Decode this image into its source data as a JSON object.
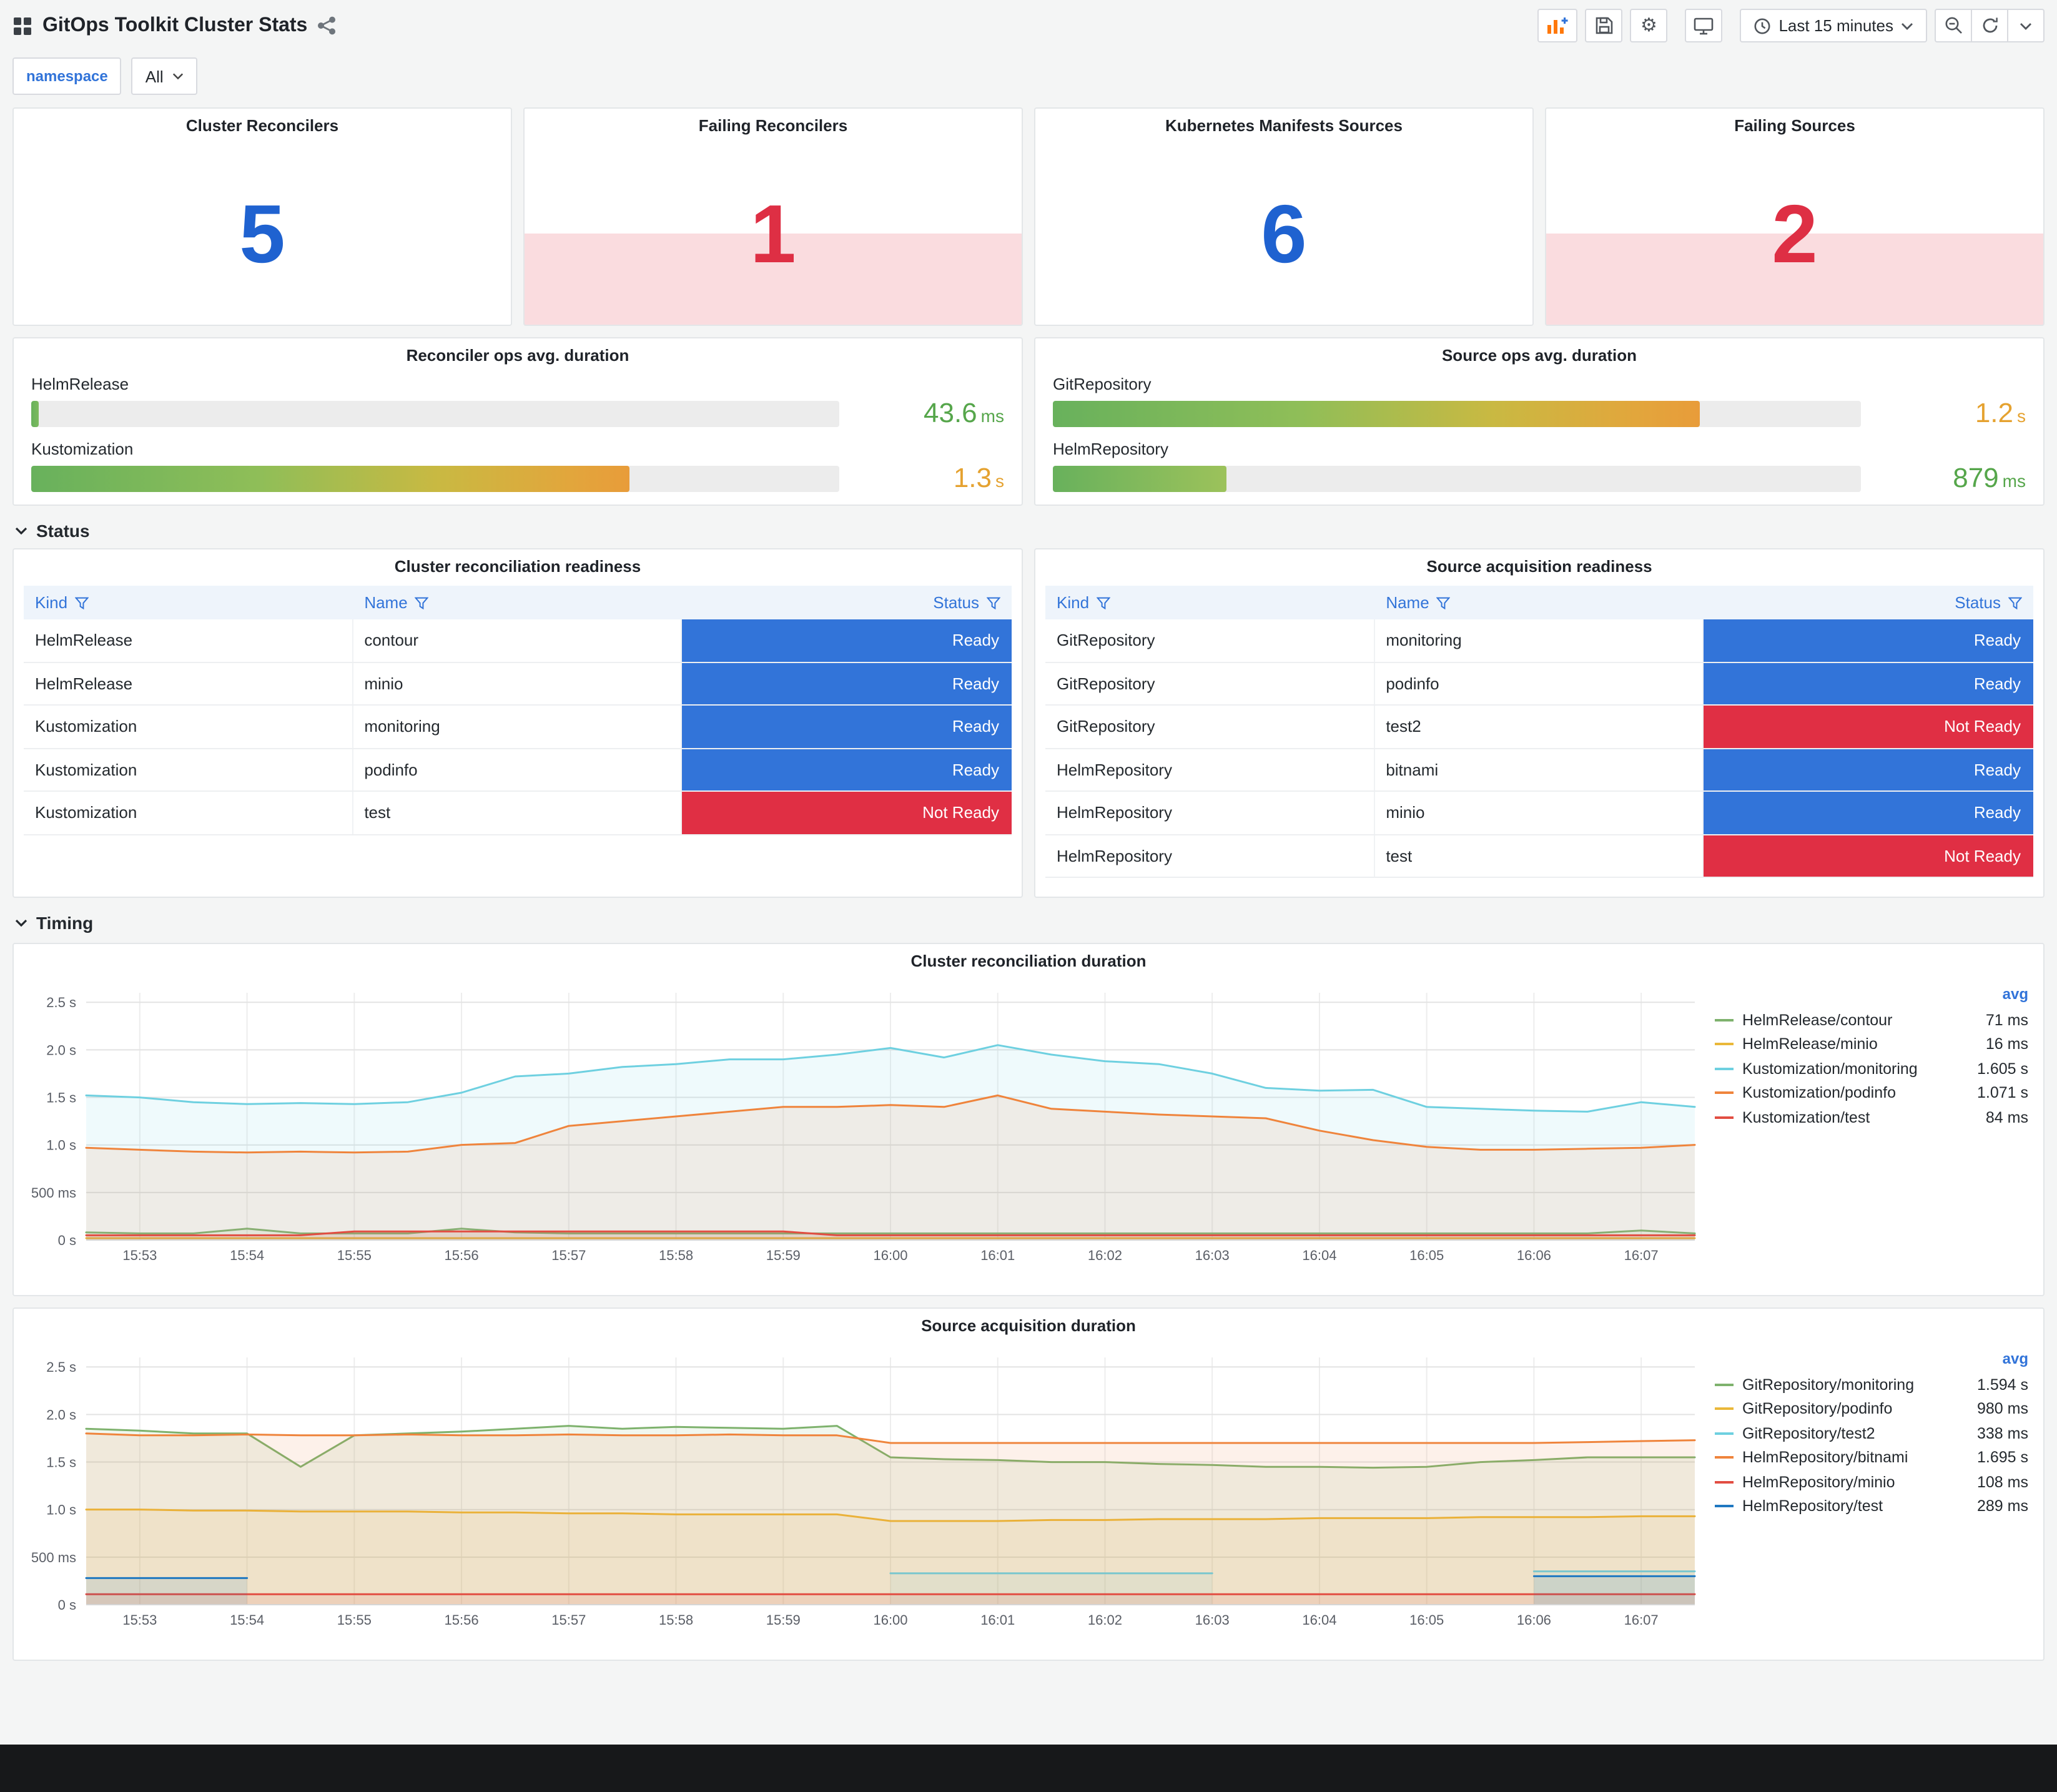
{
  "header": {
    "title": "GitOps Toolkit Cluster Stats",
    "time_range": "Last 15 minutes"
  },
  "icons": {
    "header_left": [
      "dashboard-grid-icon",
      "share-icon"
    ],
    "toolbar": [
      "add-panel-icon",
      "save-icon",
      "settings-gear-icon",
      "cycle-view-icon",
      "clock-icon",
      "zoom-out-icon",
      "refresh-icon",
      "chevron-down-icon"
    ],
    "table_header": "filter-funnel-icon",
    "section": "chevron-down-icon"
  },
  "filters": {
    "label": "namespace",
    "value": "All"
  },
  "stat_panels": [
    {
      "title": "Cluster Reconcilers",
      "value": "5",
      "color": "blue"
    },
    {
      "title": "Failing Reconcilers",
      "value": "1",
      "color": "red"
    },
    {
      "title": "Kubernetes Manifests Sources",
      "value": "6",
      "color": "blue"
    },
    {
      "title": "Failing Sources",
      "value": "2",
      "color": "red"
    }
  ],
  "gauge_panels": [
    {
      "title": "Reconciler ops avg. duration",
      "rows": [
        {
          "label": "HelmRelease",
          "num": "43.6",
          "unit": "ms",
          "value_color": "green",
          "pct": 0.9,
          "style": "green"
        },
        {
          "label": "Kustomization",
          "num": "1.3",
          "unit": "s",
          "value_color": "orange",
          "pct": 74,
          "style": "grad"
        }
      ]
    },
    {
      "title": "Source ops avg. duration",
      "rows": [
        {
          "label": "GitRepository",
          "num": "1.2",
          "unit": "s",
          "value_color": "orange",
          "pct": 80,
          "style": "grad"
        },
        {
          "label": "HelmRepository",
          "num": "879",
          "unit": "ms",
          "value_color": "green",
          "pct": 21.5,
          "style": "green2"
        }
      ]
    }
  ],
  "sections": {
    "status": "Status",
    "timing": "Timing"
  },
  "tables": [
    {
      "title": "Cluster reconciliation readiness",
      "columns": [
        "Kind",
        "Name",
        "Status"
      ],
      "rows": [
        [
          "HelmRelease",
          "contour",
          "Ready"
        ],
        [
          "HelmRelease",
          "minio",
          "Ready"
        ],
        [
          "Kustomization",
          "monitoring",
          "Ready"
        ],
        [
          "Kustomization",
          "podinfo",
          "Ready"
        ],
        [
          "Kustomization",
          "test",
          "Not Ready"
        ]
      ]
    },
    {
      "title": "Source acquisition readiness",
      "columns": [
        "Kind",
        "Name",
        "Status"
      ],
      "rows": [
        [
          "GitRepository",
          "monitoring",
          "Ready"
        ],
        [
          "GitRepository",
          "podinfo",
          "Ready"
        ],
        [
          "GitRepository",
          "test2",
          "Not Ready"
        ],
        [
          "HelmRepository",
          "bitnami",
          "Ready"
        ],
        [
          "HelmRepository",
          "minio",
          "Ready"
        ],
        [
          "HelmRepository",
          "test",
          "Not Ready"
        ]
      ]
    }
  ],
  "chart_data": [
    {
      "type": "area",
      "title": "Cluster reconciliation duration",
      "legend_header": "avg",
      "legend_position": "right",
      "grid": true,
      "ylim": [
        0,
        2.6
      ],
      "y_ticks": [
        {
          "v": 0,
          "label": "0 s"
        },
        {
          "v": 0.5,
          "label": "500 ms"
        },
        {
          "v": 1.0,
          "label": "1.0 s"
        },
        {
          "v": 1.5,
          "label": "1.5 s"
        },
        {
          "v": 2.0,
          "label": "2.0 s"
        },
        {
          "v": 2.5,
          "label": "2.5 s"
        }
      ],
      "x_ticks": [
        "15:53",
        "15:54",
        "15:55",
        "15:56",
        "15:57",
        "15:58",
        "15:59",
        "16:00",
        "16:01",
        "16:02",
        "16:03",
        "16:04",
        "16:05",
        "16:06",
        "16:07"
      ],
      "x_range": [
        "15:52:30",
        "16:07:30"
      ],
      "step_seconds": 30,
      "unit": "seconds",
      "series": [
        {
          "name": "HelmRelease/contour",
          "color": "#7EB26D",
          "avg": "71 ms",
          "values": [
            0.08,
            0.07,
            0.07,
            0.12,
            0.07,
            0.07,
            0.07,
            0.12,
            0.08,
            0.07,
            0.07,
            0.07,
            0.07,
            0.07,
            0.07,
            0.07,
            0.07,
            0.07,
            0.07,
            0.07,
            0.07,
            0.07,
            0.07,
            0.07,
            0.07,
            0.07,
            0.07,
            0.07,
            0.07,
            0.1,
            0.07
          ]
        },
        {
          "name": "HelmRelease/minio",
          "color": "#EAB839",
          "avg": "16 ms",
          "values": [
            0.02,
            0.02,
            0.02,
            0.02,
            0.02,
            0.02,
            0.02,
            0.02,
            0.02,
            0.02,
            0.02,
            0.02,
            0.02,
            0.02,
            0.02,
            0.02,
            0.02,
            0.02,
            0.02,
            0.02,
            0.02,
            0.02,
            0.02,
            0.02,
            0.02,
            0.02,
            0.02,
            0.02,
            0.02,
            0.02,
            0.02
          ]
        },
        {
          "name": "Kustomization/monitoring",
          "color": "#6ED0E0",
          "avg": "1.605 s",
          "values": [
            1.52,
            1.5,
            1.45,
            1.43,
            1.44,
            1.43,
            1.45,
            1.55,
            1.72,
            1.75,
            1.82,
            1.85,
            1.9,
            1.9,
            1.95,
            2.02,
            1.92,
            2.05,
            1.95,
            1.88,
            1.85,
            1.75,
            1.6,
            1.57,
            1.58,
            1.4,
            1.38,
            1.36,
            1.35,
            1.45,
            1.4
          ]
        },
        {
          "name": "Kustomization/podinfo",
          "color": "#EF843C",
          "avg": "1.071 s",
          "values": [
            0.97,
            0.95,
            0.93,
            0.92,
            0.93,
            0.92,
            0.93,
            1.0,
            1.02,
            1.2,
            1.25,
            1.3,
            1.35,
            1.4,
            1.4,
            1.42,
            1.4,
            1.52,
            1.38,
            1.35,
            1.32,
            1.3,
            1.28,
            1.15,
            1.05,
            0.98,
            0.95,
            0.95,
            0.96,
            0.97,
            1.0
          ]
        },
        {
          "name": "Kustomization/test",
          "color": "#E24D42",
          "avg": "84 ms",
          "values": [
            0.05,
            0.05,
            0.05,
            0.05,
            0.05,
            0.09,
            0.09,
            0.09,
            0.09,
            0.09,
            0.09,
            0.09,
            0.09,
            0.09,
            0.05,
            0.05,
            0.05,
            0.05,
            0.05,
            0.05,
            0.05,
            0.05,
            0.05,
            0.05,
            0.05,
            0.05,
            0.05,
            0.05,
            0.05,
            0.05,
            0.05
          ]
        }
      ]
    },
    {
      "type": "area",
      "title": "Source acquisition duration",
      "legend_header": "avg",
      "legend_position": "right",
      "grid": true,
      "ylim": [
        0,
        2.6
      ],
      "y_ticks": [
        {
          "v": 0,
          "label": "0 s"
        },
        {
          "v": 0.5,
          "label": "500 ms"
        },
        {
          "v": 1.0,
          "label": "1.0 s"
        },
        {
          "v": 1.5,
          "label": "1.5 s"
        },
        {
          "v": 2.0,
          "label": "2.0 s"
        },
        {
          "v": 2.5,
          "label": "2.5 s"
        }
      ],
      "x_ticks": [
        "15:53",
        "15:54",
        "15:55",
        "15:56",
        "15:57",
        "15:58",
        "15:59",
        "16:00",
        "16:01",
        "16:02",
        "16:03",
        "16:04",
        "16:05",
        "16:06",
        "16:07"
      ],
      "x_range": [
        "15:52:30",
        "16:07:30"
      ],
      "step_seconds": 30,
      "unit": "seconds",
      "series": [
        {
          "name": "GitRepository/monitoring",
          "color": "#7EB26D",
          "avg": "1.594 s",
          "values": [
            1.85,
            1.83,
            1.8,
            1.8,
            1.45,
            1.78,
            1.8,
            1.82,
            1.85,
            1.88,
            1.85,
            1.87,
            1.86,
            1.85,
            1.88,
            1.55,
            1.53,
            1.52,
            1.5,
            1.5,
            1.48,
            1.47,
            1.45,
            1.45,
            1.44,
            1.45,
            1.5,
            1.52,
            1.55,
            1.55,
            1.55
          ]
        },
        {
          "name": "GitRepository/podinfo",
          "color": "#EAB839",
          "avg": "980 ms",
          "values": [
            1.0,
            1.0,
            0.99,
            0.99,
            0.98,
            0.98,
            0.98,
            0.97,
            0.97,
            0.96,
            0.96,
            0.95,
            0.95,
            0.95,
            0.95,
            0.88,
            0.88,
            0.88,
            0.89,
            0.89,
            0.9,
            0.9,
            0.9,
            0.91,
            0.91,
            0.91,
            0.92,
            0.92,
            0.92,
            0.93,
            0.93
          ]
        },
        {
          "name": "GitRepository/test2",
          "color": "#6ED0E0",
          "avg": "338 ms",
          "values": [
            null,
            null,
            null,
            null,
            null,
            null,
            null,
            null,
            null,
            null,
            null,
            null,
            null,
            null,
            null,
            0.33,
            0.33,
            0.33,
            0.33,
            0.33,
            0.33,
            0.33,
            null,
            null,
            null,
            null,
            null,
            0.35,
            0.35,
            0.35,
            0.35
          ]
        },
        {
          "name": "HelmRepository/bitnami",
          "color": "#EF843C",
          "avg": "1.695 s",
          "values": [
            1.8,
            1.78,
            1.78,
            1.79,
            1.78,
            1.78,
            1.79,
            1.78,
            1.78,
            1.79,
            1.78,
            1.78,
            1.79,
            1.78,
            1.78,
            1.7,
            1.7,
            1.7,
            1.7,
            1.7,
            1.7,
            1.7,
            1.7,
            1.7,
            1.7,
            1.7,
            1.7,
            1.7,
            1.71,
            1.72,
            1.73
          ]
        },
        {
          "name": "HelmRepository/minio",
          "color": "#E24D42",
          "avg": "108 ms",
          "values": [
            0.11,
            0.11,
            0.11,
            0.11,
            0.11,
            0.11,
            0.11,
            0.11,
            0.11,
            0.11,
            0.11,
            0.11,
            0.11,
            0.11,
            0.11,
            0.11,
            0.11,
            0.11,
            0.11,
            0.11,
            0.11,
            0.11,
            0.11,
            0.11,
            0.11,
            0.11,
            0.11,
            0.11,
            0.11,
            0.11,
            0.11
          ]
        },
        {
          "name": "HelmRepository/test",
          "color": "#1F78C1",
          "avg": "289 ms",
          "values": [
            0.28,
            0.28,
            0.28,
            0.28,
            null,
            null,
            null,
            null,
            null,
            null,
            null,
            null,
            null,
            null,
            null,
            null,
            null,
            null,
            null,
            null,
            null,
            null,
            null,
            null,
            null,
            null,
            null,
            0.3,
            0.3,
            0.3,
            0.3
          ]
        }
      ]
    }
  ],
  "colors": {
    "stat_blue": "#1F62D0",
    "stat_red": "#DE2F44",
    "ready": "#3274D9",
    "not_ready": "#E02F44",
    "value_green": "#56A64B",
    "value_orange": "#E5A230",
    "header_link_blue": "#3274D9",
    "page_background": "#f4f5f5"
  }
}
